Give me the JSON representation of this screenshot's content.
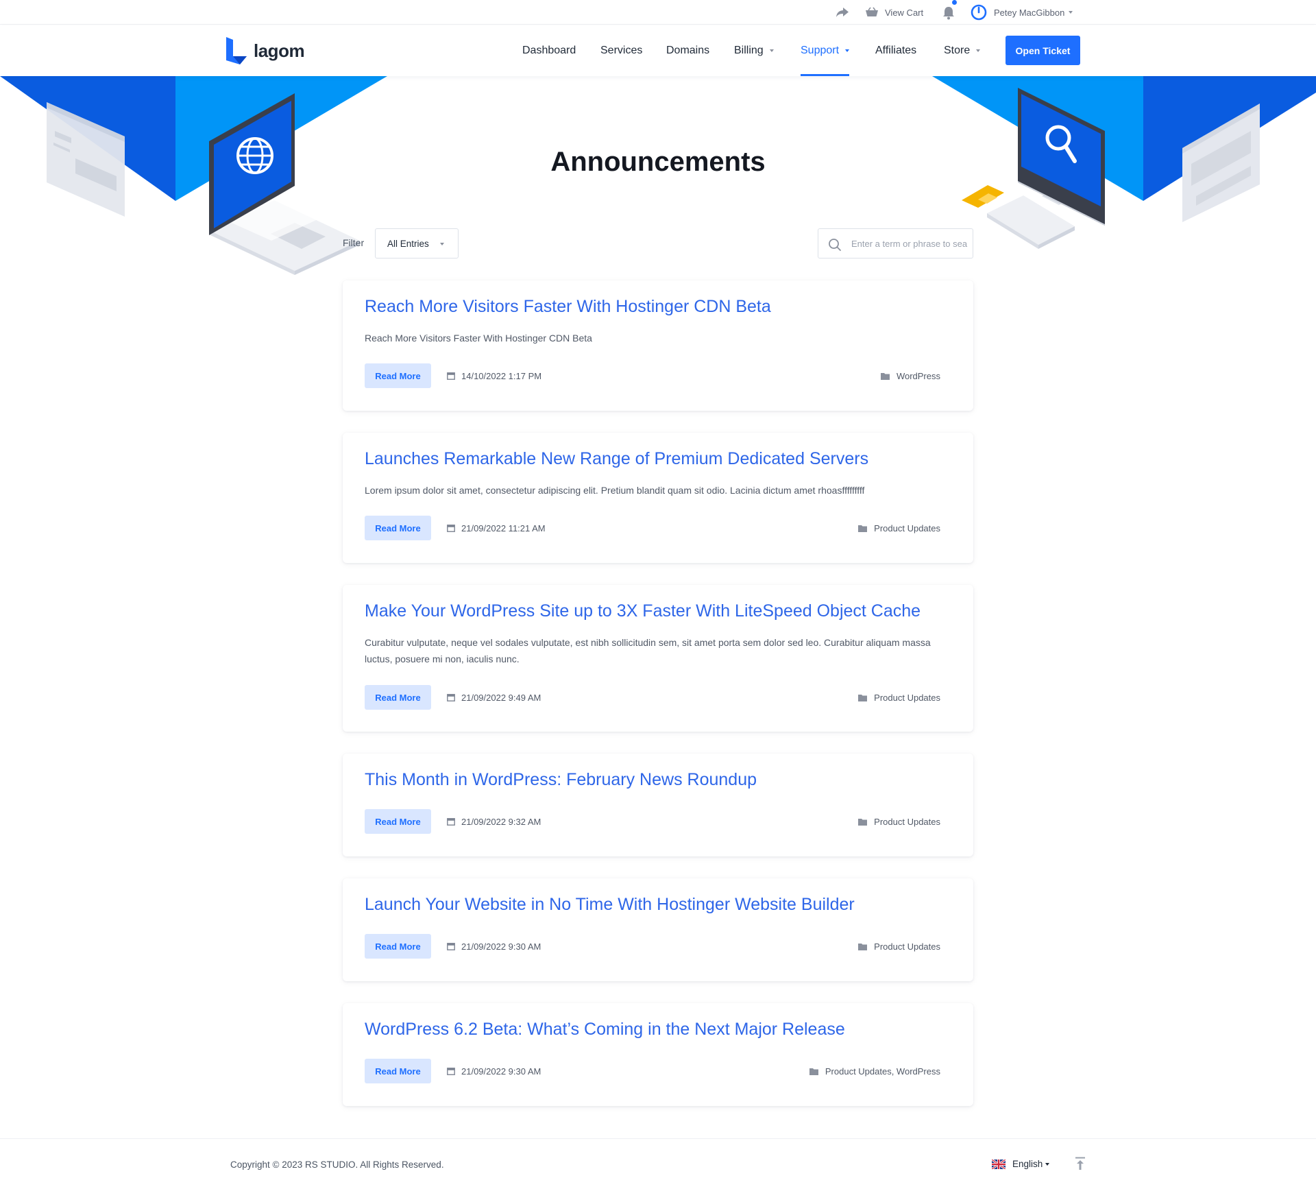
{
  "topbar": {
    "view_cart": "View Cart",
    "user_name": "Petey MacGibbon"
  },
  "brand": {
    "name": "lagom"
  },
  "nav": {
    "items": [
      {
        "label": "Dashboard"
      },
      {
        "label": "Services"
      },
      {
        "label": "Domains"
      },
      {
        "label": "Billing"
      },
      {
        "label": "Support"
      },
      {
        "label": "Affiliates"
      },
      {
        "label": "Store"
      }
    ],
    "active": "Support",
    "cta": "Open Ticket"
  },
  "page": {
    "title": "Announcements",
    "filter_label": "Filter",
    "filter_value": "All Entries",
    "search_placeholder": "Enter a term or phrase to search"
  },
  "read_more_label": "Read More",
  "announcements": [
    {
      "title": "Reach More Visitors Faster With Hostinger CDN Beta",
      "excerpt": "Reach More Visitors Faster With Hostinger CDN Beta",
      "date": "14/10/2022 1:17 PM",
      "category": "WordPress"
    },
    {
      "title": "Launches Remarkable New Range of Premium Dedicated Servers",
      "excerpt": "Lorem ipsum dolor sit amet, consectetur adipiscing elit. Pretium blandit quam sit odio. Lacinia dictum amet rhoasfffffffff",
      "date": "21/09/2022 11:21 AM",
      "category": "Product Updates"
    },
    {
      "title": "Make Your WordPress Site up to 3X Faster With LiteSpeed Object Cache",
      "excerpt": "Curabitur vulputate, neque vel sodales vulputate, est nibh sollicitudin sem, sit amet porta sem dolor sed leo. Curabitur aliquam massa luctus, posuere mi non, iaculis nunc.",
      "date": "21/09/2022 9:49 AM",
      "category": "Product Updates"
    },
    {
      "title": "This Month in WordPress: February News Roundup",
      "excerpt": "",
      "date": "21/09/2022 9:32 AM",
      "category": "Product Updates"
    },
    {
      "title": "Launch Your Website in No Time With Hostinger Website Builder",
      "excerpt": "",
      "date": "21/09/2022 9:30 AM",
      "category": "Product Updates"
    },
    {
      "title": "WordPress 6.2 Beta: What’s Coming in the Next Major Release",
      "excerpt": "",
      "date": "21/09/2022 9:30 AM",
      "category": "Product Updates, WordPress"
    }
  ],
  "footer": {
    "copyright": "Copyright © 2023 RS STUDIO. All Rights Reserved.",
    "language": "English"
  },
  "colors": {
    "accent": "#1e6fff",
    "title_link": "#2e66e8",
    "hero_blue": "#0a5ce0",
    "hero_light": "#0195f7"
  }
}
